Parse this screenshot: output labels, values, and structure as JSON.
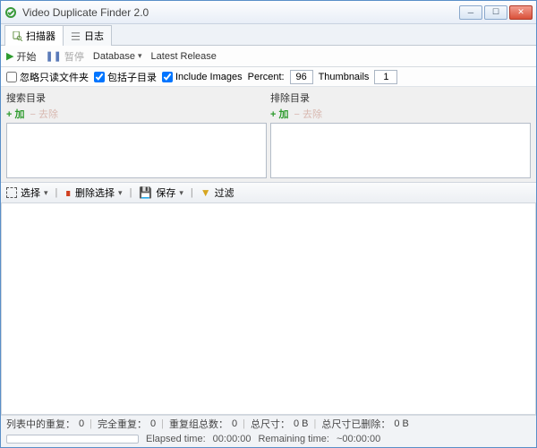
{
  "window": {
    "title": "Video Duplicate Finder 2.0"
  },
  "tabs": {
    "scanner": "扫描器",
    "log": "日志"
  },
  "toolbar1": {
    "start": "开始",
    "pause": "暂停",
    "database": "Database",
    "latest": "Latest Release"
  },
  "options": {
    "ignore_readonly_label": "忽略只读文件夹",
    "include_subdirs_label": "包括子目录",
    "include_images_label": "Include Images",
    "percent_label": "Percent:",
    "percent_value": "96",
    "thumbnails_label": "Thumbnails",
    "thumbnails_value": "1"
  },
  "search_dirs": {
    "title": "搜索目录",
    "add": "加",
    "remove": "去除"
  },
  "exclude_dirs": {
    "title": "排除目录",
    "add": "加",
    "remove": "去除"
  },
  "toolbar2": {
    "select": "选择",
    "delete_selection": "删除选择",
    "save": "保存",
    "filter": "过滤"
  },
  "status": {
    "dup_in_list_label": "列表中的重复：",
    "dup_in_list_value": "0",
    "full_dup_label": "完全重复：",
    "full_dup_value": "0",
    "dup_groups_label": "重复组总数：",
    "dup_groups_value": "0",
    "total_size_label": "总尺寸：",
    "total_size_value": "0 B",
    "size_removed_label": "总尺寸已删除：",
    "size_removed_value": "0 B"
  },
  "timebar": {
    "elapsed_label": "Elapsed time:",
    "elapsed_value": "00:00:00",
    "remaining_label": "Remaining time:",
    "remaining_value": "~00:00:00"
  },
  "colors": {
    "accent_green": "#2e9b2e",
    "accent_red": "#d04020"
  }
}
